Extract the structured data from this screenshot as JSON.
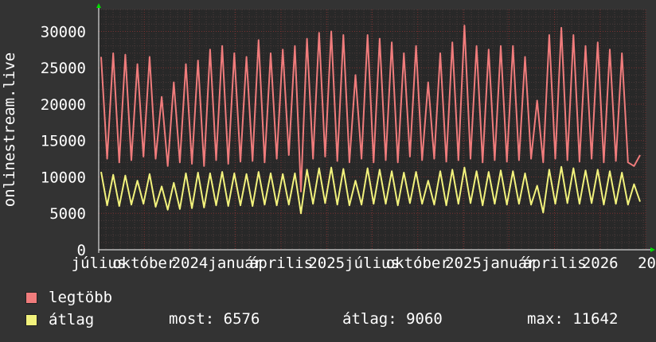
{
  "chart_data": {
    "type": "line",
    "ylabel": "onlinestream.live",
    "ylim": [
      0,
      33000
    ],
    "yticks": [
      "0",
      "5000",
      "10000",
      "15000",
      "20000",
      "25000",
      "30000"
    ],
    "xticks": [
      "július",
      "október",
      "2024",
      "január",
      "április",
      "2025",
      "július",
      "október",
      "2025",
      "január",
      "április",
      "2026",
      "20"
    ],
    "grid": true,
    "series": [
      {
        "name": "legtöbb",
        "color": "#f07c7c",
        "values": [
          26500,
          12500,
          27000,
          12000,
          26800,
          12300,
          25500,
          12800,
          26500,
          12500,
          21000,
          11500,
          23000,
          12000,
          25500,
          11800,
          26000,
          11500,
          27500,
          12300,
          28000,
          11800,
          27000,
          12100,
          26500,
          12200,
          28800,
          12000,
          27000,
          12500,
          27500,
          13000,
          28000,
          8000,
          29000,
          12500,
          29800,
          12800,
          30000,
          12200,
          29500,
          12000,
          24000,
          12500,
          29500,
          12000,
          29000,
          12300,
          28500,
          12000,
          27000,
          12800,
          28000,
          12300,
          23000,
          12500,
          27000,
          12100,
          28500,
          12300,
          30800,
          12500,
          28000,
          12000,
          27500,
          12300,
          28000,
          12100,
          28000,
          12300,
          26500,
          12500,
          20500,
          12000,
          29500,
          12500,
          30500,
          12300,
          29500,
          12100,
          28000,
          12500,
          28500,
          12000,
          27500,
          12200,
          27000,
          12000,
          11500,
          13000
        ]
      },
      {
        "name": "átlag",
        "color": "#f2f27c",
        "values": [
          10700,
          6100,
          10300,
          6000,
          10200,
          6200,
          9500,
          6300,
          10400,
          5900,
          8700,
          5500,
          9200,
          5600,
          10500,
          5700,
          10600,
          5800,
          10500,
          6100,
          10700,
          6000,
          10500,
          6100,
          10400,
          6000,
          10700,
          6200,
          10500,
          6100,
          10400,
          6200,
          10500,
          5000,
          11000,
          6300,
          11200,
          6400,
          11300,
          6200,
          11100,
          6100,
          9500,
          6200,
          11200,
          6300,
          11000,
          6300,
          10800,
          6100,
          10600,
          6400,
          10700,
          6300,
          9500,
          6200,
          10800,
          6100,
          11000,
          6300,
          11300,
          6400,
          10800,
          6100,
          10700,
          6300,
          10900,
          6200,
          10800,
          6300,
          10500,
          6200,
          8800,
          5100,
          11000,
          6300,
          11400,
          6400,
          11200,
          6300,
          10900,
          6400,
          11000,
          6200,
          10800,
          6300,
          10600,
          6200,
          9000,
          6600
        ]
      }
    ]
  },
  "legend": {
    "items": [
      {
        "label": "legtöbb",
        "color": "#f07c7c"
      },
      {
        "label": "átlag",
        "color": "#f2f27c"
      }
    ],
    "stats": {
      "most": "most: 6576",
      "atlag": "átlag: 9060",
      "max": "max: 11642"
    }
  },
  "colors": {
    "background": "#333333",
    "plot_background": "#282828",
    "grid_minor": "#4a3a3a",
    "grid_major": "#7a3030",
    "arrow": "#00dd00",
    "text": "#ffffff"
  }
}
